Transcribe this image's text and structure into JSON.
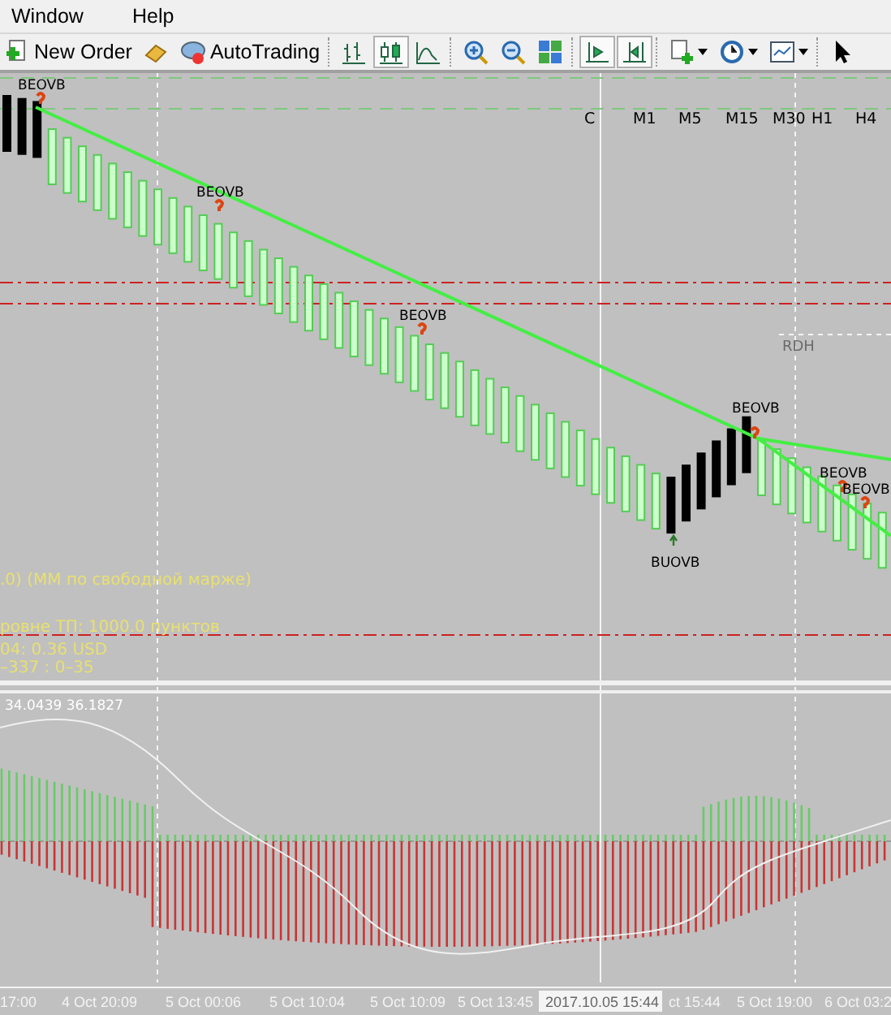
{
  "menu": [
    {
      "label": "Window"
    },
    {
      "label": "Help"
    }
  ],
  "toolbar": [
    {
      "label": "New Order",
      "pressed": false
    },
    {
      "pressed": false
    },
    {
      "label": "AutoTrading",
      "pressed": false
    },
    {
      "pressed": false
    },
    {
      "pressed": true
    },
    {
      "pressed": false
    },
    {
      "pressed": false
    },
    {
      "pressed": false
    },
    {
      "pressed": false
    },
    {
      "pressed": true
    },
    {
      "pressed": true
    },
    {
      "pressed": false,
      "dropdown": true
    },
    {
      "pressed": false,
      "dropdown": true
    },
    {
      "pressed": false,
      "dropdown": true
    },
    {
      "pressed": false
    }
  ],
  "chart": {
    "timeframes": [
      {
        "label": "C"
      },
      {
        "label": "M1"
      },
      {
        "label": "M5"
      },
      {
        "label": "M15"
      },
      {
        "label": "M30"
      },
      {
        "label": "H1"
      },
      {
        "label": "H4"
      }
    ],
    "signals": [
      {
        "label": "BEOVB",
        "kind": "sell"
      },
      {
        "label": "BEOVB",
        "kind": "sell"
      },
      {
        "label": "BEOVB",
        "kind": "sell"
      },
      {
        "label": "BUOVB",
        "kind": "buy"
      },
      {
        "label": "BEOVB",
        "kind": "sell"
      },
      {
        "label": "BEOVB",
        "kind": "sell"
      },
      {
        "label": "BEOVB",
        "kind": "sell"
      }
    ],
    "level_label": "RDH",
    "info_lines": [
      ".0) (ММ по свободной марже)",
      "ровне ТП: 1000.0 пунктов",
      "04: 0.36 USD",
      "–337 : 0–35"
    ]
  },
  "indicator": {
    "reading": "34.0439 36.1827"
  },
  "time_axis": {
    "labels": [
      "17:00",
      "4 Oct 20:09",
      "5 Oct 00:06",
      "5 Oct 10:04",
      "5 Oct 10:09",
      "5 Oct 13:45",
      "ct 15:44",
      "5 Oct 19:00",
      "6 Oct 03:2"
    ],
    "crosshair_time": "2017.10.05 15:44"
  }
}
